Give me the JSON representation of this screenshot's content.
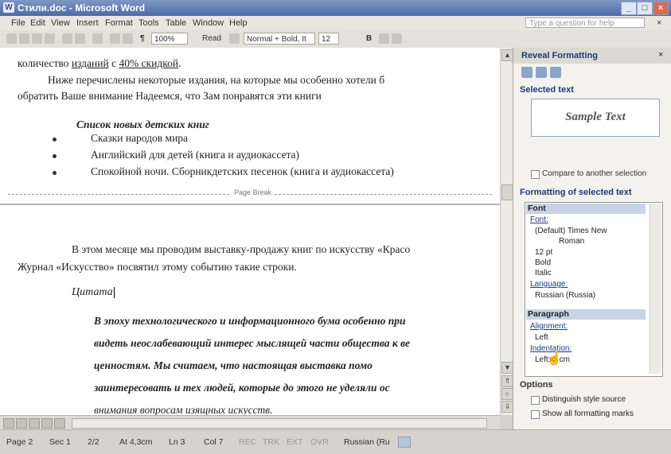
{
  "window": {
    "title": "Стили.doc - Microsoft Word",
    "icon": "word-app-icon",
    "buttons": [
      "_",
      "□",
      "×"
    ]
  },
  "menubar": {
    "items": [
      "File",
      "Edit",
      "View",
      "Insert",
      "Format",
      "Tools",
      "Table",
      "Window",
      "Help"
    ],
    "ask_placeholder": "Type a question for help",
    "close_doc": "×"
  },
  "toolbar": {
    "zoom": "100%",
    "read": "Read",
    "style": "Normal + Bold, It",
    "size": "12",
    "bold": "B",
    "pilcrow": "¶"
  },
  "document": {
    "page1": {
      "line1_pre": "количество ",
      "line1_link1": "изданий",
      "line1_mid": " с ",
      "line1_link2": "40% скидкой",
      "line1_post": ".",
      "para2_line1": "Ниже перечислены некоторые издания, на которые мы особенно хотели б",
      "para2_line2": "обратить Ваше внимание  Надеемся, что Зам понравятся эти книги",
      "list_title": "Список новых детских книг",
      "list_items": [
        "Сказки народов мира",
        "Английский для детей (книга и аудиокассета)",
        "Спокойной ночи.  Сборникдетских песенок (книга и аудиокассета)"
      ]
    },
    "page_break_label": "Page Break",
    "page2": {
      "para_line1": "В этом месяце мы проводим выставку-продажу книг по искусству «Красо",
      "para_line2": "Журнал «Искусство» посвятил этому событию такие строки.",
      "heading": "Цитата",
      "quote_lines": [
        "В эпоху технологического и информационного бума особенно при",
        "видеть неослабевающий интерес мыслящей части общества к ве",
        "ценностям.  Мы  считаем,   что   настоящая   выставка   помо",
        "заинтересовать и тех людей, которые до этого не уделяли ос",
        "внимания вопросам изящных искусств."
      ]
    }
  },
  "taskpane": {
    "title": "Reveal Formatting",
    "selected_text_label": "Selected text",
    "sample_text": "Sample Text",
    "compare_label": "Compare to another selection",
    "formatting_label": "Formatting of selected text",
    "font_group": "Font",
    "font_link": "Font:",
    "font_lines": [
      "(Default) Times New",
      "Roman",
      "12 pt",
      "Bold",
      "Italic"
    ],
    "language_link": "Language:",
    "language_value": "Russian (Russia)",
    "paragraph_group": "Paragraph",
    "alignment_link": "Alignment:",
    "alignment_value": "Left",
    "indentation_link": "Indentation:",
    "indent_value": "Left: 0 cm",
    "options_label": "Options",
    "distinguish_label": "Distinguish style source",
    "show_marks_label": "Show all formatting marks"
  },
  "statusbar": {
    "page": "Page 2",
    "sec": "Sec 1",
    "pages": "2/2",
    "at": "At 4,3cm",
    "ln": "Ln 3",
    "col": "Col 7",
    "rec": "REC",
    "trk": "TRK",
    "ext": "EXT",
    "ovr": "OVR",
    "language": "Russian (Ru"
  }
}
